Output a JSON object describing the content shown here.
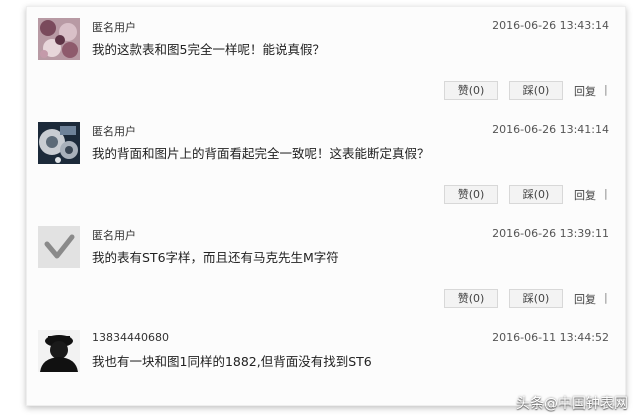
{
  "comments": [
    {
      "user": "匿名用户",
      "time": "2016-06-26 13:43:14",
      "text": "我的这款表和图5完全一样呢！能说真假？",
      "like": "赞(0)",
      "dislike": "踩(0)",
      "reply": "回复",
      "sep": "|",
      "avatar": "floral-pattern-avatar"
    },
    {
      "user": "匿名用户",
      "time": "2016-06-26 13:41:14",
      "text": "我的背面和图片上的背面看起完全一致呢！这表能断定真假？",
      "like": "赞(0)",
      "dislike": "踩(0)",
      "reply": "回复",
      "sep": "|",
      "avatar": "gear-avatar"
    },
    {
      "user": "匿名用户",
      "time": "2016-06-26 13:39:11",
      "text": "我的表有ST6字样，而且还有马克先生M字符",
      "like": "赞(0)",
      "dislike": "踩(0)",
      "reply": "回复",
      "sep": "|",
      "avatar": "checkmark-avatar"
    },
    {
      "user": "13834440680",
      "time": "2016-06-11 13:44:52",
      "text": "我也有一块和图1同样的1882,但背面没有找到ST6",
      "like": "",
      "dislike": "",
      "reply": "",
      "sep": "",
      "avatar": "silhouette-avatar"
    }
  ],
  "watermark": "头条@中国钟表网"
}
